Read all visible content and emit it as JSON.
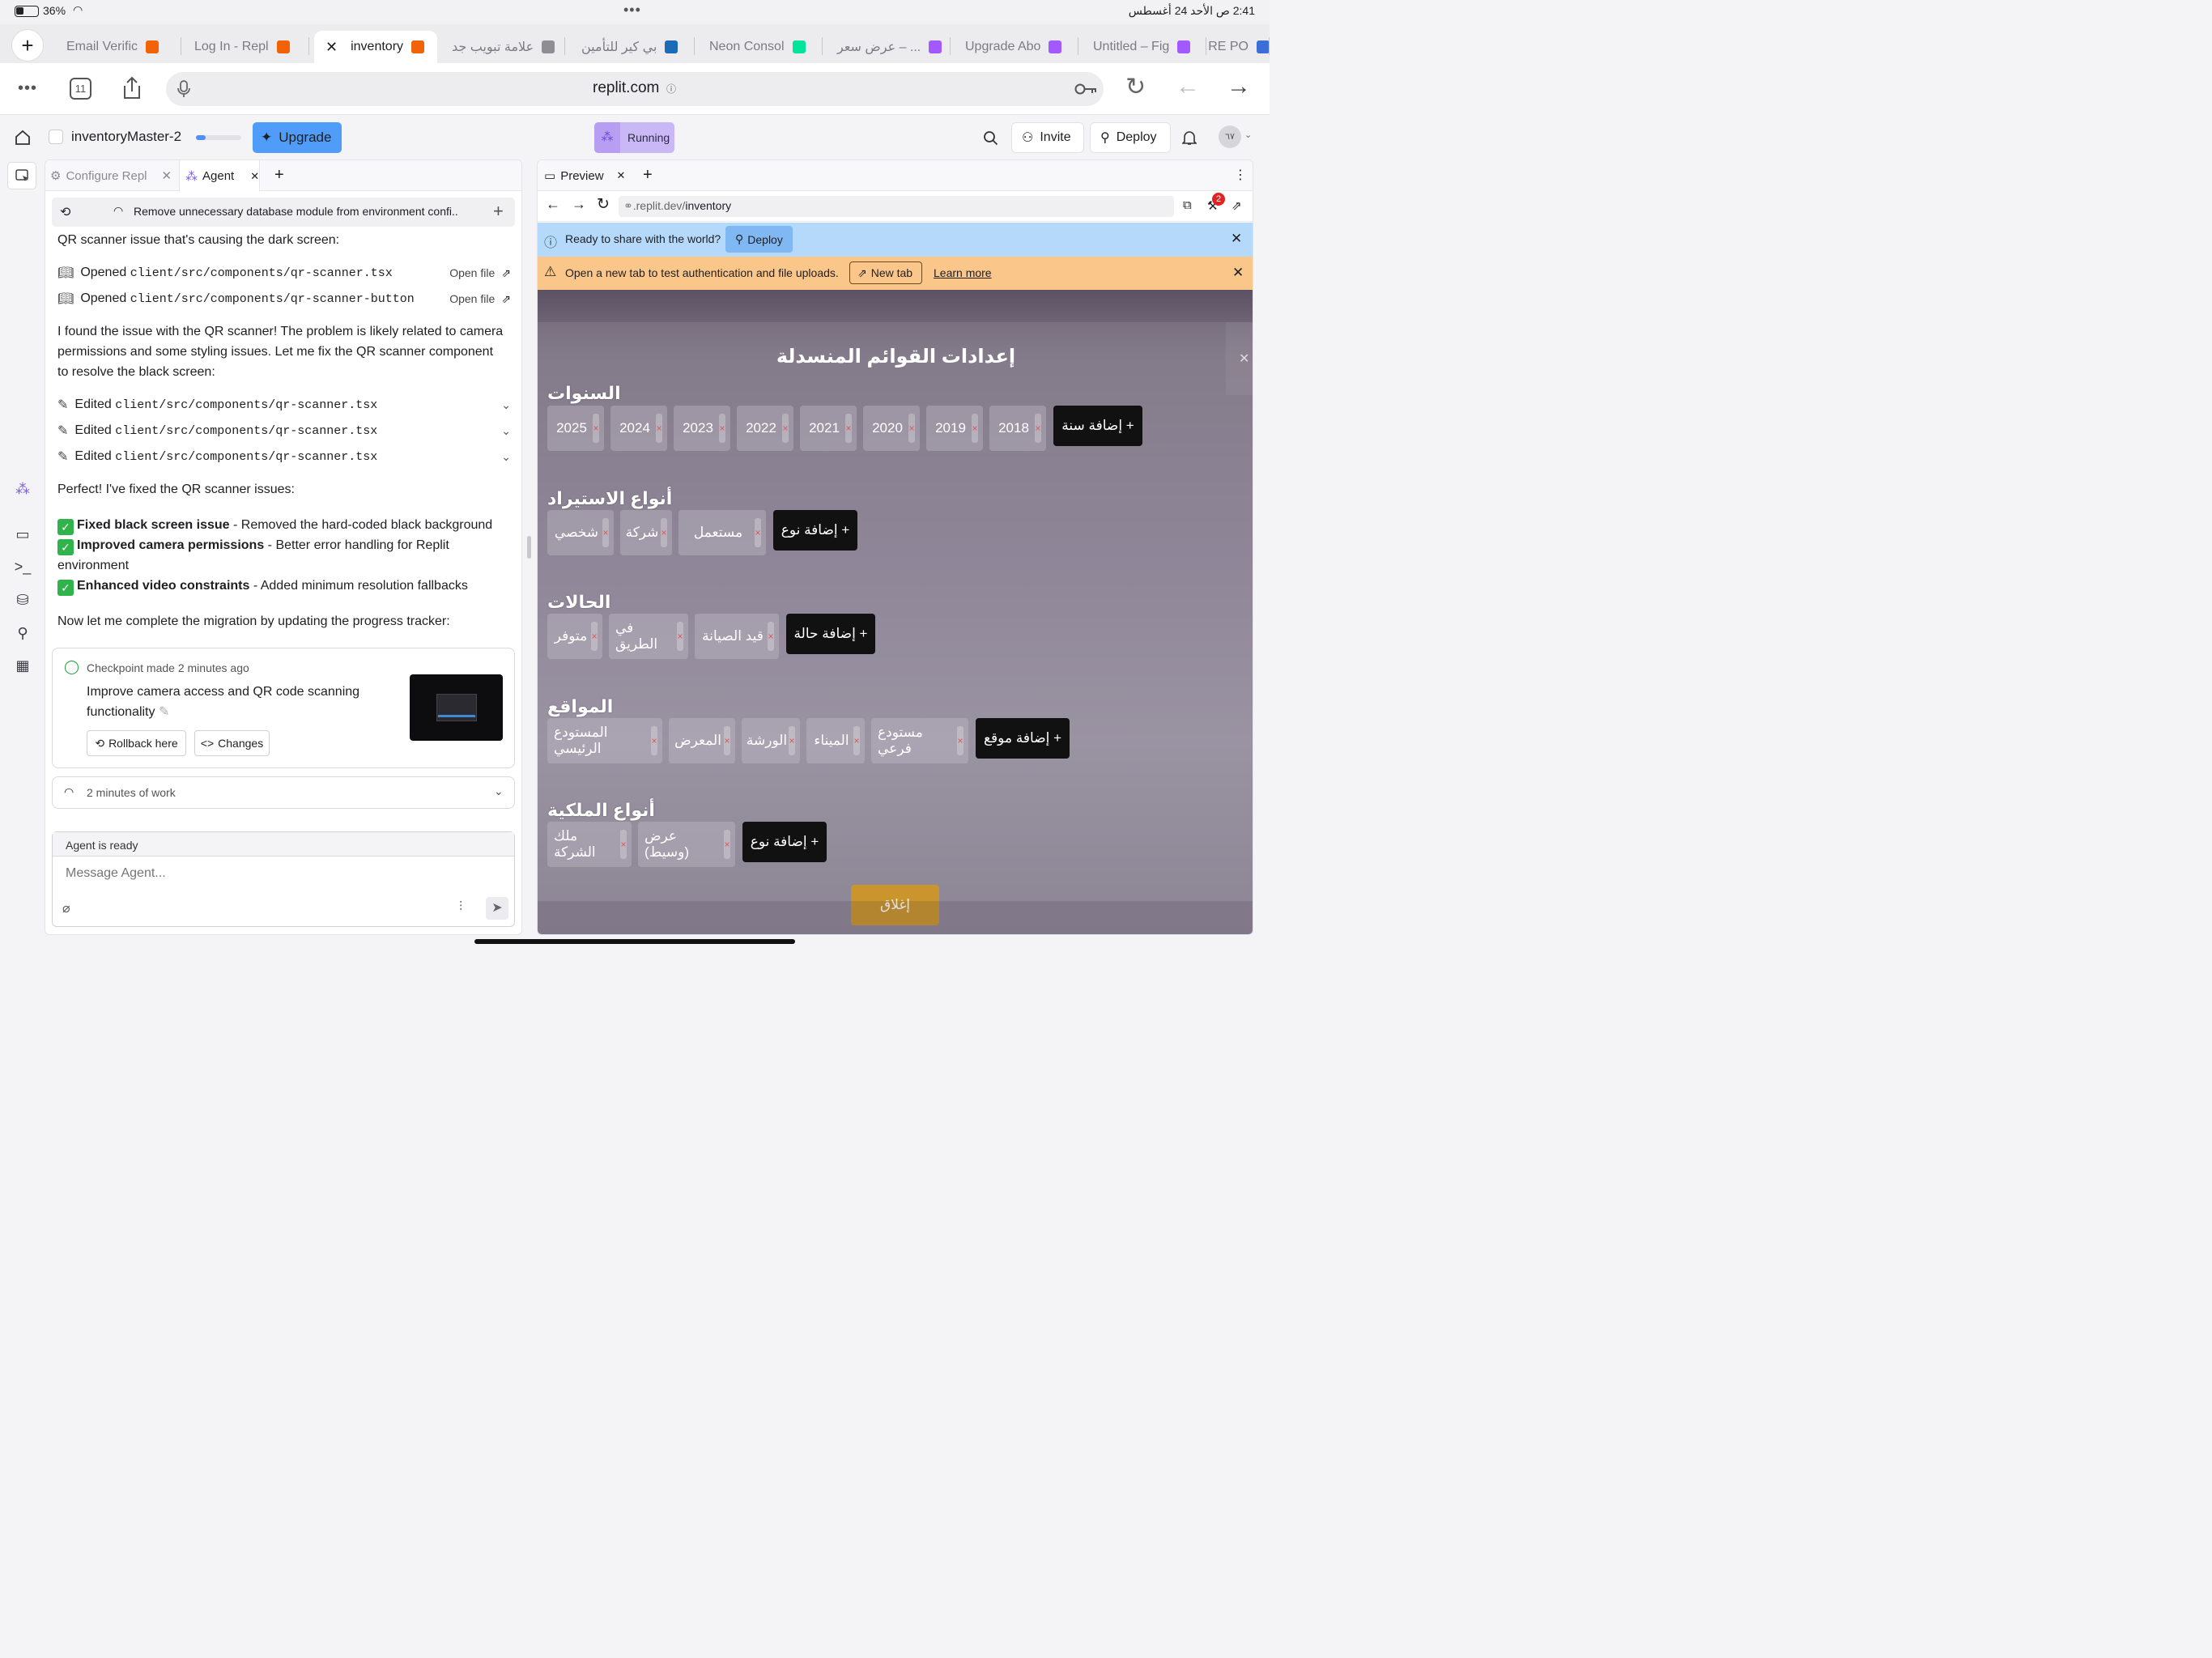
{
  "status_bar": {
    "battery": "36%",
    "time_date": "2:41 ص   الأحد 24 أغسطس"
  },
  "browser_tabs": [
    {
      "label": "Email Verific",
      "color": "#f26207"
    },
    {
      "label": "Log In - Repl",
      "color": "#f26207"
    },
    {
      "label": "inventory",
      "color": "#f26207",
      "active": true
    },
    {
      "label": "علامة تبويب جد",
      "color": "#8e8e93"
    },
    {
      "label": "بي كير للتأمين",
      "color": "#1a6bb8"
    },
    {
      "label": "Neon Consol",
      "color": "#00e599"
    },
    {
      "label": "عرض سعر – ...",
      "color": "#a259ff"
    },
    {
      "label": "Upgrade Abo",
      "color": "#a259ff"
    },
    {
      "label": "Untitled – Fig",
      "color": "#a259ff"
    },
    {
      "label": "RE PO",
      "color": "#3b6ed6"
    }
  ],
  "urlbar": {
    "tab_count": "11",
    "url": "replit.com"
  },
  "topbar": {
    "project": "inventoryMaster-2",
    "upgrade": "Upgrade",
    "running": "Running",
    "invite": "Invite",
    "deploy": "Deploy",
    "avatar": "٦٧"
  },
  "agent_tabs": {
    "configure": "Configure Repl",
    "agent": "Agent"
  },
  "agent": {
    "task_title": "Remove unnecessary database module from environment confi..",
    "intro": "QR scanner issue that's causing the dark screen:",
    "opened": [
      {
        "prefix": "Opened ",
        "path": "client/src/components/qr-scanner.tsx",
        "action": "Open file"
      },
      {
        "prefix": "Opened ",
        "path": "client/src/components/qr-scanner-button.t...",
        "action": "Open file"
      }
    ],
    "found_text": "I found the issue with the QR scanner! The problem is likely related to camera permissions and some styling issues. Let me fix the QR scanner component to resolve the black screen:",
    "edited": [
      {
        "prefix": "Edited ",
        "path": "client/src/components/qr-scanner.tsx"
      },
      {
        "prefix": "Edited ",
        "path": "client/src/components/qr-scanner.tsx"
      },
      {
        "prefix": "Edited ",
        "path": "client/src/components/qr-scanner.tsx"
      }
    ],
    "perfect": "Perfect! I've fixed the QR scanner issues:",
    "fixes": [
      {
        "bold": "Fixed black screen issue",
        "rest": " - Removed the hard-coded black background"
      },
      {
        "bold": "Improved camera permissions",
        "rest": " - Better error handling for Replit environment"
      },
      {
        "bold": "Enhanced video constraints",
        "rest": " - Added minimum resolution fallbacks"
      }
    ],
    "now_text": "Now let me complete the migration by updating the progress tracker:",
    "checkpoint": {
      "label": "Checkpoint made",
      "time": "2 minutes ago",
      "title": "Improve camera access and QR code scanning functionality",
      "rollback": "Rollback here",
      "changes": "Changes"
    },
    "work": "2 minutes of work",
    "ready": "Agent is ready",
    "placeholder": "Message Agent..."
  },
  "preview": {
    "tab": "Preview",
    "url_prefix": ".replit.dev/",
    "url_path": "inventory",
    "badge": "2",
    "share_text": "Ready to share with the world?",
    "share_btn": "Deploy",
    "warn_text": "Open a new tab to test authentication and file uploads.",
    "newtab": "New tab",
    "learn": "Learn more"
  },
  "modal": {
    "title": "إعدادات القوائم المنسدلة",
    "sections": [
      {
        "title": "السنوات",
        "chips": [
          "2025",
          "2024",
          "2023",
          "2022",
          "2021",
          "2020",
          "2019",
          "2018"
        ],
        "add": "+ إضافة سنة"
      },
      {
        "title": "أنواع الاستيراد",
        "chips": [
          "شخصي",
          "شركة",
          "مستعمل"
        ],
        "add": "+ إضافة نوع"
      },
      {
        "title": "الحالات",
        "chips": [
          "متوفر",
          "في الطريق",
          "قيد الصيانة"
        ],
        "add": "+ إضافة حالة"
      },
      {
        "title": "المواقع",
        "chips": [
          "المستودع الرئيسي",
          "المعرض",
          "الورشة",
          "الميناء",
          "مستودع فرعي"
        ],
        "add": "+ إضافة موقع"
      },
      {
        "title": "أنواع الملكية",
        "chips": [
          "ملك الشركة",
          "عرض (وسيط)"
        ],
        "add": "+ إضافة نوع"
      }
    ],
    "close": "إغلاق"
  }
}
